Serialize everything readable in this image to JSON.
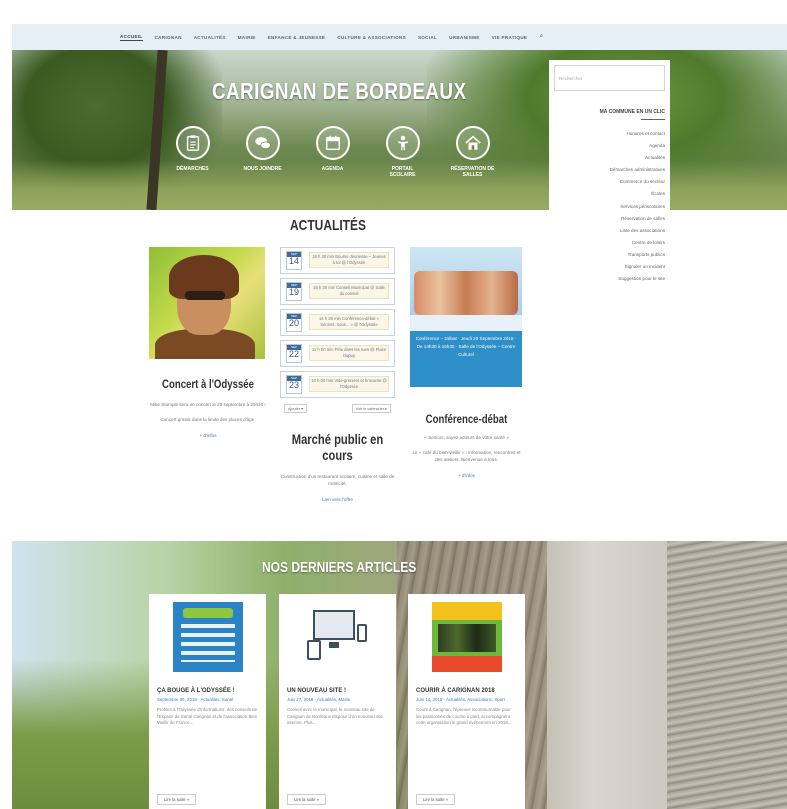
{
  "nav": {
    "items": [
      "Accueil",
      "Carignan",
      "Actualités",
      "Mairie",
      "Enfance & Jeunesse",
      "Culture & Associations",
      "Social",
      "Urbanisme",
      "Vie pratique"
    ],
    "active_index": 0,
    "search_icon": "search-icon"
  },
  "hero": {
    "site_title": "CARIGNAN DE BORDEAUX",
    "shortcuts": [
      {
        "label": "Démarches",
        "icon": "clipboard-icon"
      },
      {
        "label": "Nous joindre",
        "icon": "chat-bubbles-icon"
      },
      {
        "label": "Agenda",
        "icon": "calendar-icon"
      },
      {
        "label": "Portail scolaire",
        "icon": "child-icon"
      },
      {
        "label": "Réservation de salles",
        "icon": "house-icon"
      }
    ]
  },
  "sidebar": {
    "search_placeholder": "Rechercher",
    "heading": "Ma commune en un clic",
    "links": [
      "Horaires et contact",
      "Agenda",
      "Actualités",
      "Démarches administratives",
      "Commerce du secteur",
      "Écoles",
      "Services périscolaires",
      "Réservation de salles",
      "Liste des associations",
      "Centre de loisirs",
      "Transports publics",
      "Signaler un incident",
      "Suggestion pour le site"
    ]
  },
  "actualites": {
    "title": "ACTUALITÉS",
    "concert": {
      "title": "Concert à l'Odyssée",
      "text1": "Mike Stumple sera en concert le 29 septembre à 20h30 !",
      "text2": "Concert gratuit dans la limite des places d'âge.",
      "more": "+ d'infos"
    },
    "events": [
      {
        "month": "SEP",
        "day": "14",
        "text": "18 h 30 min Bourse Jeunesse – Jeunes à toi @ l'Odyssée"
      },
      {
        "month": "SEP",
        "day": "19",
        "text": "18 h 30 min Conseil Municipal @ Salle du conseil"
      },
      {
        "month": "SEP",
        "day": "20",
        "text": "14 h 30 min Conférence-débat « Seniors, nous... » @ l'Odyssée"
      },
      {
        "month": "SEP",
        "day": "22",
        "text": "11 h 00 min Fête dans les rues @ Place Dupuy"
      },
      {
        "month": "SEP",
        "day": "23",
        "text": "10 h 00 min Vide-greniers et brocante @ l'Odyssée"
      }
    ],
    "cal_left": "Ajouter ▾",
    "cal_right": "Voir le calendrier ▸",
    "marche": {
      "title": "Marché public en cours",
      "text": "Construction d'un restaurant scolaire, cuisine et salle de motricité.",
      "more": "Lien vers l'offre"
    },
    "conference": {
      "poster_text": "Conférence – Débat · Jeudi 20 Septembre 2018 · De 14h30 à 16h30 · Salle de l'Odyssée – Centre Culturel",
      "title": "Conférence-débat",
      "text1": "« Seniors, soyez acteurs de votre santé »",
      "text2": "Le « café du bien-vieillir » : information, rencontres et des ateliers. Bienvenue à tous.",
      "more": "+ d'infos"
    }
  },
  "articles": {
    "title": "NOS DERNIERS ARTICLES",
    "items": [
      {
        "title": "Ça bouge à l'Odyssée !",
        "meta": "Septembre 06, 2018 · Actualités, Santé",
        "excerpt": "Profitez à l'Odyssée d'informations, des conseils de l'Espace de Santé Carignan et de l'association Bien Vieillir de France...",
        "button": "Lire la suite »"
      },
      {
        "title": "Un nouveau site !",
        "meta": "Juin 27, 2018 · Actualités, Mairie",
        "excerpt": "Conseil avec le municipal, le nouveau site de Carignan de Bordeaux dispose d'un nouveau site internet. Plus...",
        "button": "Lire la suite »"
      },
      {
        "title": "Courir à Carignan 2018",
        "meta": "Juin 14, 2018 · Actualités, Associations, Sport",
        "excerpt": "Courir à Carignan, l'épreuve incontournable pour les passionnés de course à pied, accompagnera cette organisation le grand événement en 2018...",
        "button": "Lire la suite »"
      }
    ]
  }
}
